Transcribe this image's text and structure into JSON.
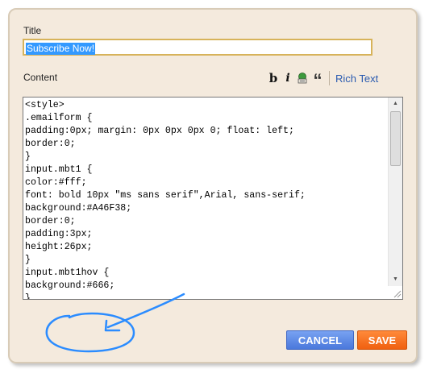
{
  "dialog": {
    "title_label": "Title",
    "title_value": "Subscribe Now!",
    "content_label": "Content",
    "rich_text_link": "Rich Text",
    "toolbar": {
      "bold": "b",
      "italic": "i",
      "quote": "“"
    },
    "code_lines": [
      "<style>",
      ".emailform {",
      "padding:0px; margin: 0px 0px 0px 0; float: left;",
      "border:0;",
      "}",
      "input.mbt1 {",
      "color:#fff;",
      "font: bold 10px \"ms sans serif\",Arial, sans-serif;",
      "background:#A46F38;",
      "border:0;",
      "padding:3px;",
      "height:26px;",
      "}",
      "input.mbt1hov {",
      "background:#666;",
      "}"
    ],
    "cancel_button": "CANCEL",
    "save_button": "SAVE"
  },
  "colors": {
    "dialog_bg": "#f4eadd",
    "cancel_button": "#4a78dc",
    "save_button": "#f06010",
    "link": "#2a5bb0",
    "annotation": "#2b8cff",
    "selection": "#3399ff"
  },
  "annotation": {
    "icon": "hand-drawn-circle-with-arrow"
  }
}
